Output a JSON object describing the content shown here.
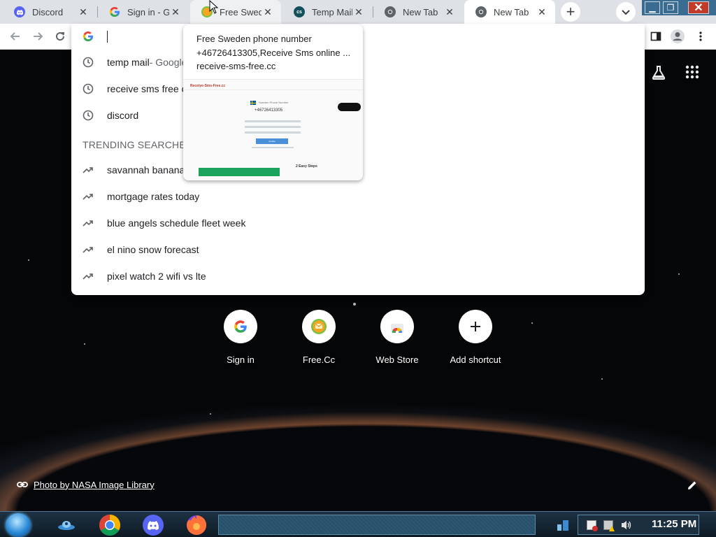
{
  "browser": {
    "tabs": [
      {
        "title": "Discord",
        "favicon": "discord-icon",
        "favicon_color": "#5865f2",
        "state": "normal"
      },
      {
        "title": "Sign in - Goo",
        "favicon": "google-g-icon",
        "favicon_color": "#ffffff",
        "state": "normal"
      },
      {
        "title": "Free Sweden",
        "favicon": "receive-sms-icon",
        "favicon_color": "#f5a623",
        "state": "hovered"
      },
      {
        "title": "Temp Mail -",
        "favicon": "temp-mail-icon",
        "favicon_color": "#13505b",
        "state": "normal"
      },
      {
        "title": "New Tab",
        "favicon": "chrome-icon",
        "favicon_color": "#5f6368",
        "state": "normal"
      },
      {
        "title": "New Tab",
        "favicon": "chrome-icon",
        "favicon_color": "#5f6368",
        "state": "active"
      }
    ],
    "new_tab_label": "+",
    "omnibox": {
      "value": "",
      "suggestions": [
        {
          "icon": "history-clock-icon",
          "text": "temp mail",
          "sub": " - Google"
        },
        {
          "icon": "history-clock-icon",
          "text": "receive sms free c",
          "sub": ""
        },
        {
          "icon": "history-clock-icon",
          "text": "discord",
          "sub": ""
        }
      ],
      "trending_header": "TRENDING SEARCHES",
      "trending": [
        {
          "icon": "trending-arrow-icon",
          "text": "savannah bananas"
        },
        {
          "icon": "trending-arrow-icon",
          "text": "mortgage rates today"
        },
        {
          "icon": "trending-arrow-icon",
          "text": "blue angels schedule fleet week"
        },
        {
          "icon": "trending-arrow-icon",
          "text": "el nino snow forecast"
        },
        {
          "icon": "trending-arrow-icon",
          "text": "pixel watch 2 wifi vs lte"
        }
      ]
    },
    "hover_card": {
      "title": "Free Sweden phone number +46726413305,Receive Sms online ...",
      "domain": "receive-sms-free.cc",
      "thumb": {
        "logo": "Receive-Sms-Free.cc",
        "heading": "Sweden Phone Number",
        "number": "+46726413305",
        "button": "Update",
        "section": "2 Easy Steps"
      }
    }
  },
  "newtab": {
    "shortcuts": [
      {
        "label": "Sign in",
        "icon": "google-g-icon"
      },
      {
        "label": "Free.Cc",
        "icon": "receive-sms-icon"
      },
      {
        "label": "Web Store",
        "icon": "web-store-icon"
      },
      {
        "label": "Add shortcut",
        "icon": "plus-icon"
      }
    ],
    "photo_credit": "Photo by NASA Image Library"
  },
  "taskbar": {
    "clock": "11:25 PM",
    "pinned": [
      "alien-app-icon",
      "chrome-icon",
      "discord-icon",
      "firefox-icon"
    ]
  }
}
